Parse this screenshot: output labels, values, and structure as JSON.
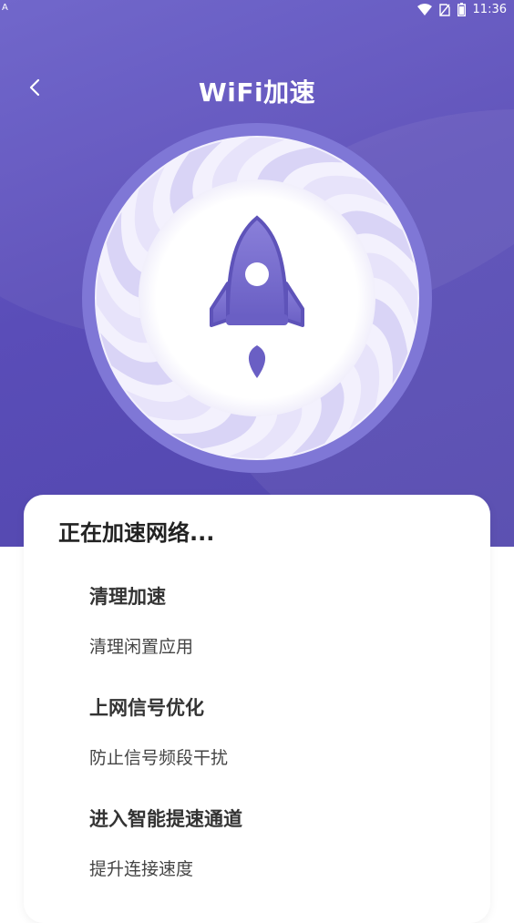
{
  "status_bar": {
    "left_indicator": "A",
    "time": "11:36",
    "icons": [
      "wifi-icon",
      "no-sim-icon",
      "battery-icon"
    ]
  },
  "header": {
    "back_icon": "chevron-left-icon",
    "title": "WiFi加速"
  },
  "hero": {
    "graphic": "rocket-icon"
  },
  "card": {
    "heading": "正在加速网络...",
    "steps": [
      {
        "title": "清理加速",
        "desc": "清理闲置应用"
      },
      {
        "title": "上网信号优化",
        "desc": "防止信号频段干扰"
      },
      {
        "title": "进入智能提速通道",
        "desc": "提升连接速度"
      }
    ]
  },
  "colors": {
    "accent": "#5a4db8",
    "ring": "#7f77d6",
    "blade": "#e9e6fb",
    "rocket": "#7a6fd0"
  }
}
